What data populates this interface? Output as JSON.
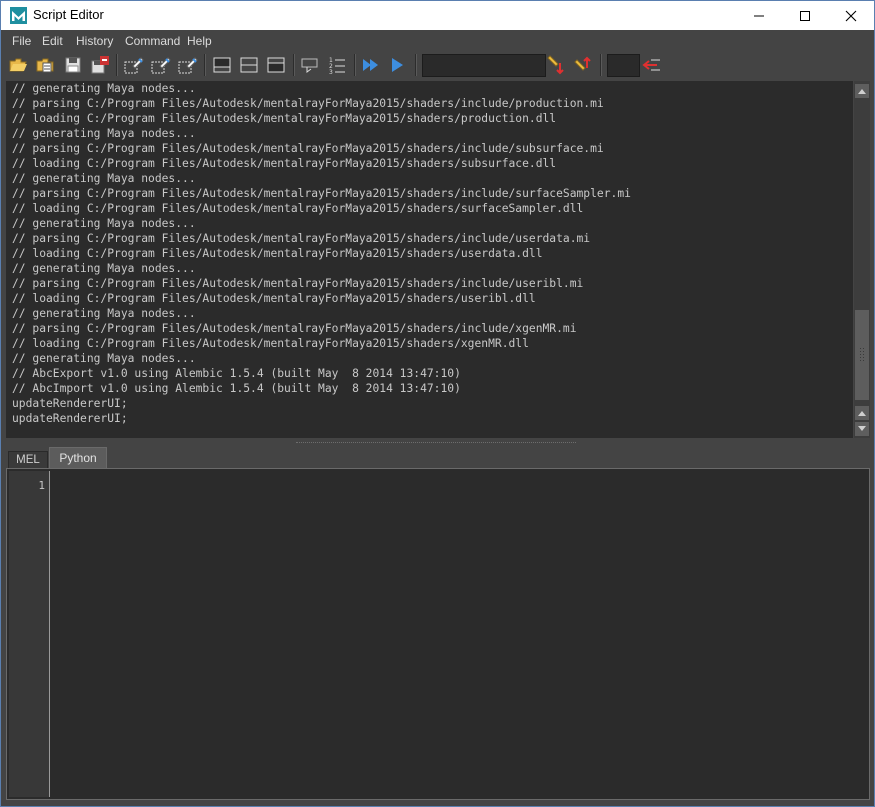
{
  "window": {
    "title": "Script Editor"
  },
  "menu": {
    "items": [
      "File",
      "Edit",
      "History",
      "Command",
      "Help"
    ]
  },
  "toolbar": {
    "buttons": [
      "open-script-icon",
      "source-script-icon",
      "save-script-icon",
      "save-to-shelf-icon",
      "clear-history-icon",
      "clear-input-icon",
      "clear-all-icon",
      "show-history-icon",
      "show-both-icon",
      "show-input-icon",
      "echo-all-commands-icon",
      "line-numbers-icon",
      "execute-all-icon",
      "execute-icon",
      "search-next-icon",
      "search-prev-icon",
      "goto-line-icon"
    ],
    "search_value": "",
    "line_value": ""
  },
  "history": {
    "lines": [
      "// generating Maya nodes...",
      "// parsing C:/Program Files/Autodesk/mentalrayForMaya2015/shaders/include/production.mi",
      "// loading C:/Program Files/Autodesk/mentalrayForMaya2015/shaders/production.dll",
      "// generating Maya nodes...",
      "// parsing C:/Program Files/Autodesk/mentalrayForMaya2015/shaders/include/subsurface.mi",
      "// loading C:/Program Files/Autodesk/mentalrayForMaya2015/shaders/subsurface.dll",
      "// generating Maya nodes...",
      "// parsing C:/Program Files/Autodesk/mentalrayForMaya2015/shaders/include/surfaceSampler.mi",
      "// loading C:/Program Files/Autodesk/mentalrayForMaya2015/shaders/surfaceSampler.dll",
      "// generating Maya nodes...",
      "// parsing C:/Program Files/Autodesk/mentalrayForMaya2015/shaders/include/userdata.mi",
      "// loading C:/Program Files/Autodesk/mentalrayForMaya2015/shaders/userdata.dll",
      "// generating Maya nodes...",
      "// parsing C:/Program Files/Autodesk/mentalrayForMaya2015/shaders/include/useribl.mi",
      "// loading C:/Program Files/Autodesk/mentalrayForMaya2015/shaders/useribl.dll",
      "// generating Maya nodes...",
      "// parsing C:/Program Files/Autodesk/mentalrayForMaya2015/shaders/include/xgenMR.mi",
      "// loading C:/Program Files/Autodesk/mentalrayForMaya2015/shaders/xgenMR.dll",
      "// generating Maya nodes...",
      "// AbcExport v1.0 using Alembic 1.5.4 (built May  8 2014 13:47:10)",
      "// AbcImport v1.0 using Alembic 1.5.4 (built May  8 2014 13:47:10)",
      "updateRendererUI;",
      "updateRendererUI;"
    ]
  },
  "tabs": {
    "mel": "MEL",
    "python": "Python",
    "active": "Python"
  },
  "editor": {
    "line_number": "1",
    "content": ""
  },
  "colors": {
    "panel_bg": "#444444",
    "text_bg": "#2b2b2b",
    "text": "#c8c8c8",
    "accent_blue": "#3d8ee0"
  }
}
